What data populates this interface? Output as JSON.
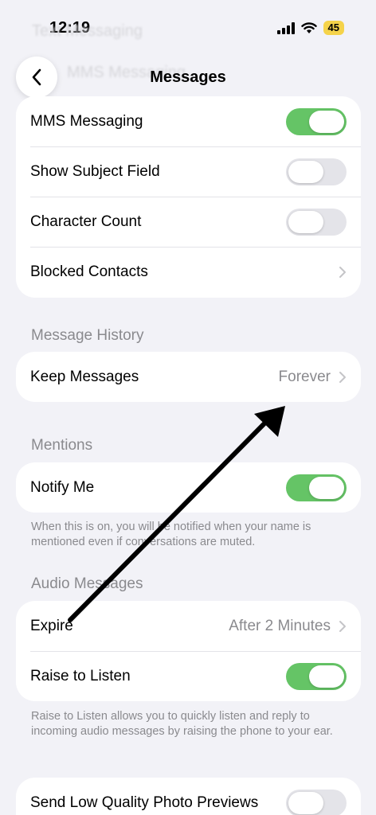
{
  "status_bar": {
    "time": "12:19",
    "battery": "45"
  },
  "ghost_rows": [
    "Text Messaging",
    "MMS Messaging"
  ],
  "nav": {
    "title": "Messages",
    "back_icon": "chevron-left-icon"
  },
  "group1": {
    "rows": [
      {
        "label": "MMS Messaging",
        "toggle": "on"
      },
      {
        "label": "Show Subject Field",
        "toggle": "off"
      },
      {
        "label": "Character Count",
        "toggle": "off"
      },
      {
        "label": "Blocked Contacts",
        "chevron": true
      }
    ]
  },
  "message_history": {
    "header": "Message History",
    "keep_messages": {
      "label": "Keep Messages",
      "value": "Forever"
    }
  },
  "mentions": {
    "header": "Mentions",
    "notify_me": {
      "label": "Notify Me",
      "toggle": "on"
    },
    "footnote": "When this is on, you will be notified when your name is mentioned even if conversations are muted."
  },
  "audio_messages": {
    "header": "Audio Messages",
    "expire": {
      "label": "Expire",
      "value": "After 2 Minutes"
    },
    "raise_to_listen": {
      "label": "Raise to Listen",
      "toggle": "on"
    },
    "footnote": "Raise to Listen allows you to quickly listen and reply to incoming audio messages by raising the phone to your ear."
  },
  "photo_previews": {
    "label": "Send Low Quality Photo Previews",
    "toggle": "off"
  },
  "colors": {
    "toggle_on": "#65c466",
    "toggle_off": "#e4e4e9",
    "background": "#f2f2f7",
    "secondary_text": "#8a8a8e",
    "battery": "#f5d34a"
  },
  "annotation": {
    "icon": "arrow-annotation",
    "color": "#000000"
  }
}
